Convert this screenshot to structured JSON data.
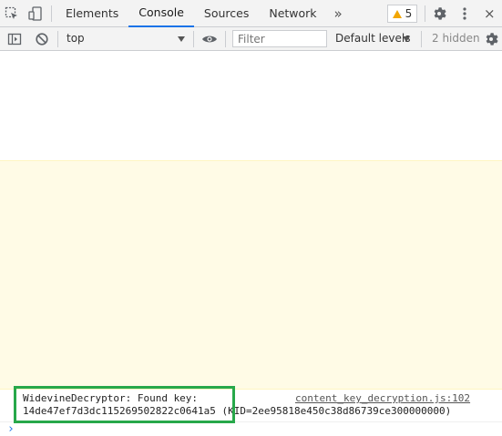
{
  "tabbar": {
    "tabs": [
      {
        "label": "Elements"
      },
      {
        "label": "Console"
      },
      {
        "label": "Sources"
      },
      {
        "label": "Network"
      }
    ],
    "more_glyph": "»",
    "warnings_count": "5",
    "close_glyph": "×",
    "active_tab": "Console",
    "accent_color": "#1a73e8",
    "warning_color": "#f2a600"
  },
  "toolbar": {
    "context": "top",
    "filter_placeholder": "Filter",
    "levels_label": "Default levels",
    "hidden_label": "2 hidden"
  },
  "console": {
    "messages": [
      {
        "line1": "WidevineDecryptor: Found key:",
        "key": "14de47ef7d3dc115269502822c0641a5",
        "kid": "(KID=2ee95818e450c38d86739ce300000000)",
        "source": "content_key_decryption.js:102"
      }
    ],
    "prompt_glyph": "›",
    "highlight_color": "#27a84a"
  }
}
